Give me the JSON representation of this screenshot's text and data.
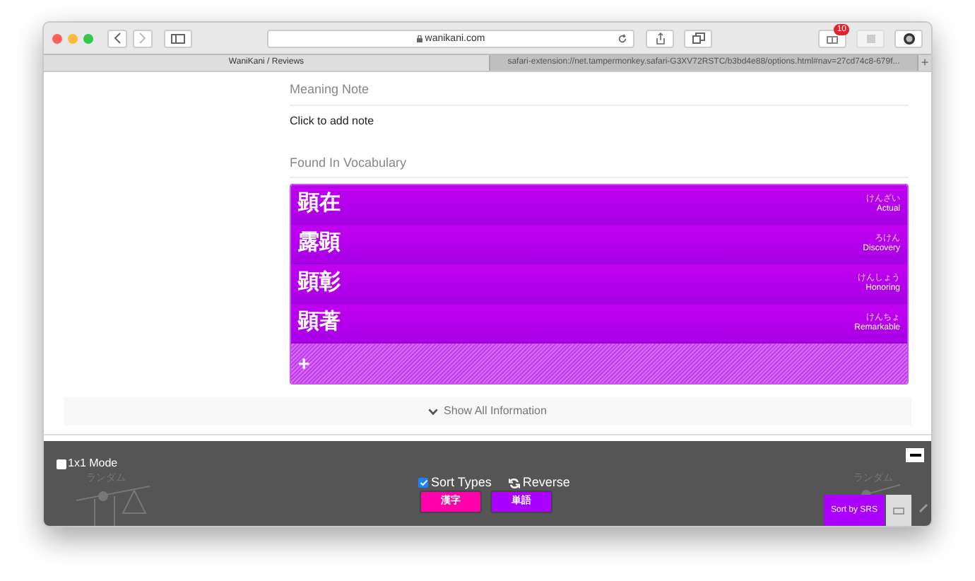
{
  "browser": {
    "url": "wanikani.com",
    "badge": "10",
    "tabs": [
      {
        "label": "WaniKani / Reviews",
        "selected": true
      },
      {
        "label": "safari-extension://net.tampermonkey.safari-G3XV72RSTC/b3bd4e88/options.html#nav=27cd74c8-679f...",
        "selected": false
      }
    ],
    "new_tab": "+"
  },
  "meaning_note": {
    "heading": "Meaning Note",
    "action": "Click to add note"
  },
  "vocabulary": {
    "heading": "Found In Vocabulary",
    "items": [
      {
        "kanji": "顕在",
        "reading": "けんざい",
        "meaning": "Actual"
      },
      {
        "kanji": "露顕",
        "reading": "ろけん",
        "meaning": "Discovery"
      },
      {
        "kanji": "顕彰",
        "reading": "けんしょう",
        "meaning": "Honoring"
      },
      {
        "kanji": "顕著",
        "reading": "けんちょ",
        "meaning": "Remarkable"
      }
    ],
    "add": "+"
  },
  "show_all": "Show All Information",
  "panel": {
    "one_by_one": {
      "label": "1x1 Mode",
      "checked": false
    },
    "sort_types": {
      "label": "Sort Types",
      "checked": true
    },
    "reverse": "Reverse",
    "ghost_labels": [
      "ランダム",
      "ランダム"
    ],
    "type_buttons": [
      {
        "label": "漢字",
        "color": "#ff00aa"
      },
      {
        "label": "単語",
        "color": "#aa00ff"
      }
    ],
    "sort_button": "Sort by SRS"
  }
}
